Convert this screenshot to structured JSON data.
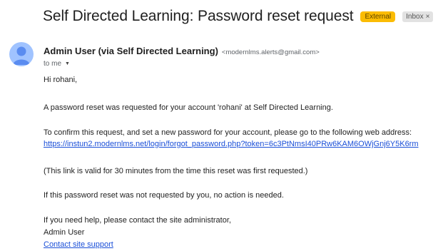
{
  "email": {
    "subject": "Self Directed Learning: Password reset request",
    "labels": {
      "external": "External",
      "inbox": "Inbox",
      "inbox_remove": "×"
    },
    "sender": {
      "name": "Admin User (via Self Directed Learning)",
      "address": "<modernlms.alerts@gmail.com>"
    },
    "recipient": "to me",
    "body": {
      "greeting": "Hi rohani,",
      "line1": "A password reset was requested for your account 'rohani' at Self Directed Learning.",
      "line2": "To confirm this request, and set a new password for your account, please go to the following web address:",
      "reset_link": "https://instun2.modernlms.net/login/forgot_password.php?token=6c3PtNmsI40PRw6KAM6OWjGnj6Y5K6rm",
      "line3": "(This link is valid for 30 minutes from the time this reset was first requested.)",
      "line4": "If this password reset was not requested by you, no action is needed.",
      "line5": "If you need help, please contact the site administrator,",
      "signature": "Admin User",
      "support_link": "Contact site support"
    }
  },
  "colors": {
    "external_badge": "#fbbc04",
    "avatar": "#a0c3ff",
    "link": "#1a4fd8"
  },
  "icons": {
    "avatar": "person-icon",
    "recipient_dropdown": "caret-down-icon",
    "label_remove": "close-icon"
  }
}
